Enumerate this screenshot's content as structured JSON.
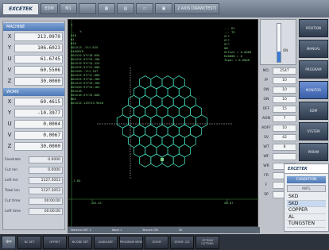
{
  "toolbar": {
    "logo": "EXCETEK",
    "buttons": [
      "EDM",
      "M1",
      "",
      "",
      "",
      "",
      "",
      "2 AXIS DRAW(TEST)"
    ]
  },
  "machine": {
    "title": "MACHINE",
    "axes": [
      {
        "label": "X",
        "value": "213.0970"
      },
      {
        "label": "Y",
        "value": "106.6023"
      },
      {
        "label": "U",
        "value": "61.6745"
      },
      {
        "label": "V",
        "value": "60.5506"
      },
      {
        "label": "Z",
        "value": "30.0000"
      }
    ]
  },
  "work": {
    "title": "WORK",
    "axes": [
      {
        "label": "X",
        "value": "60.4615"
      },
      {
        "label": "Y",
        "value": "-10.3977"
      },
      {
        "label": "U",
        "value": "0.0004"
      },
      {
        "label": "V",
        "value": "0.0067"
      },
      {
        "label": "Z",
        "value": "30.0000"
      }
    ]
  },
  "info": [
    {
      "label": "Feedrate",
      "value": "0.0000"
    },
    {
      "label": "Cut len",
      "value": "0.0000"
    },
    {
      "label": "Left len",
      "value": "1127.3053"
    },
    {
      "label": "Total len",
      "value": "1127.3053"
    },
    {
      "label": "Cut time",
      "value": "00:00:00"
    },
    {
      "label": "Left time",
      "value": "00:00:00"
    }
  ],
  "program": {
    "lines": [
      "---  %",
      "G40",
      "N1",
      "N10",
      "G01X13.-Y11.625",
      "G40X0Y0",
      "G01X19.97Y18.894",
      "G01X25.97Y23.106",
      "G01X19.97Y14.224",
      "G01X25.97Y11.006",
      "G01X30.-Y11.167",
      "G01X25.97Y11.686",
      "G01X25.97Y16.268",
      "G01X19.97Y19.200",
      "G01X30.97Y14.165",
      "G01X18.",
      "G01X18.97Y15.800",
      "M02",
      "G01X15.135Y13.9010"
    ],
    "side": [
      "--- D1",
      "--- T5",
      "G**",
      "G**",
      "G**",
      "ON",
      "Offset = 0.0000",
      "Re0000 = 0",
      "Taper = 0.0000"
    ],
    "axis_labels": {
      "y_top": "Y",
      "y_mark": "-7.84",
      "x_left": "-26.35",
      "x_right": "26.07"
    }
  },
  "params": {
    "gauge_label": "ON",
    "rows": [
      {
        "label": "NO.",
        "value": "2547"
      },
      {
        "label": "IP",
        "value": "10"
      },
      {
        "label": "ON",
        "value": "10"
      },
      {
        "label": "ON",
        "value": "10"
      },
      {
        "label": "OFF",
        "value": "15"
      },
      {
        "label": "AON",
        "value": "7"
      },
      {
        "label": "AOFF",
        "value": "10"
      },
      {
        "label": "SV",
        "value": "42"
      },
      {
        "label": "WT",
        "value": "8"
      },
      {
        "label": "WF",
        "value": ""
      },
      {
        "label": "WR",
        "value": ""
      },
      {
        "label": "FR",
        "value": ""
      },
      {
        "label": "F",
        "value": ""
      },
      {
        "label": "SP",
        "value": ""
      }
    ]
  },
  "nav": [
    "POSITION",
    "MANUAL",
    "PROGRAM",
    "MONITOR",
    "EDM",
    "SYSTEM",
    "PARAM"
  ],
  "condition": {
    "logo": "EXCETEK",
    "title": "CONDITION",
    "subtitle": "MATL",
    "materials": [
      "SKD",
      "SKD",
      "COPPER",
      "AL",
      "TUNGSTEN"
    ]
  },
  "status": {
    "items": [
      "Material SET 1",
      "Work 1",
      "Branch ON",
      "30"
    ]
  },
  "bottom": {
    "back": "⇦",
    "keys": [
      "NC SET",
      "OFFSET",
      "NCODE SET",
      "AUXILIARY",
      "PROGRAM VIEW",
      "ZOOM",
      "ZOOM -1/2",
      "GT RUN CUTTING"
    ]
  }
}
